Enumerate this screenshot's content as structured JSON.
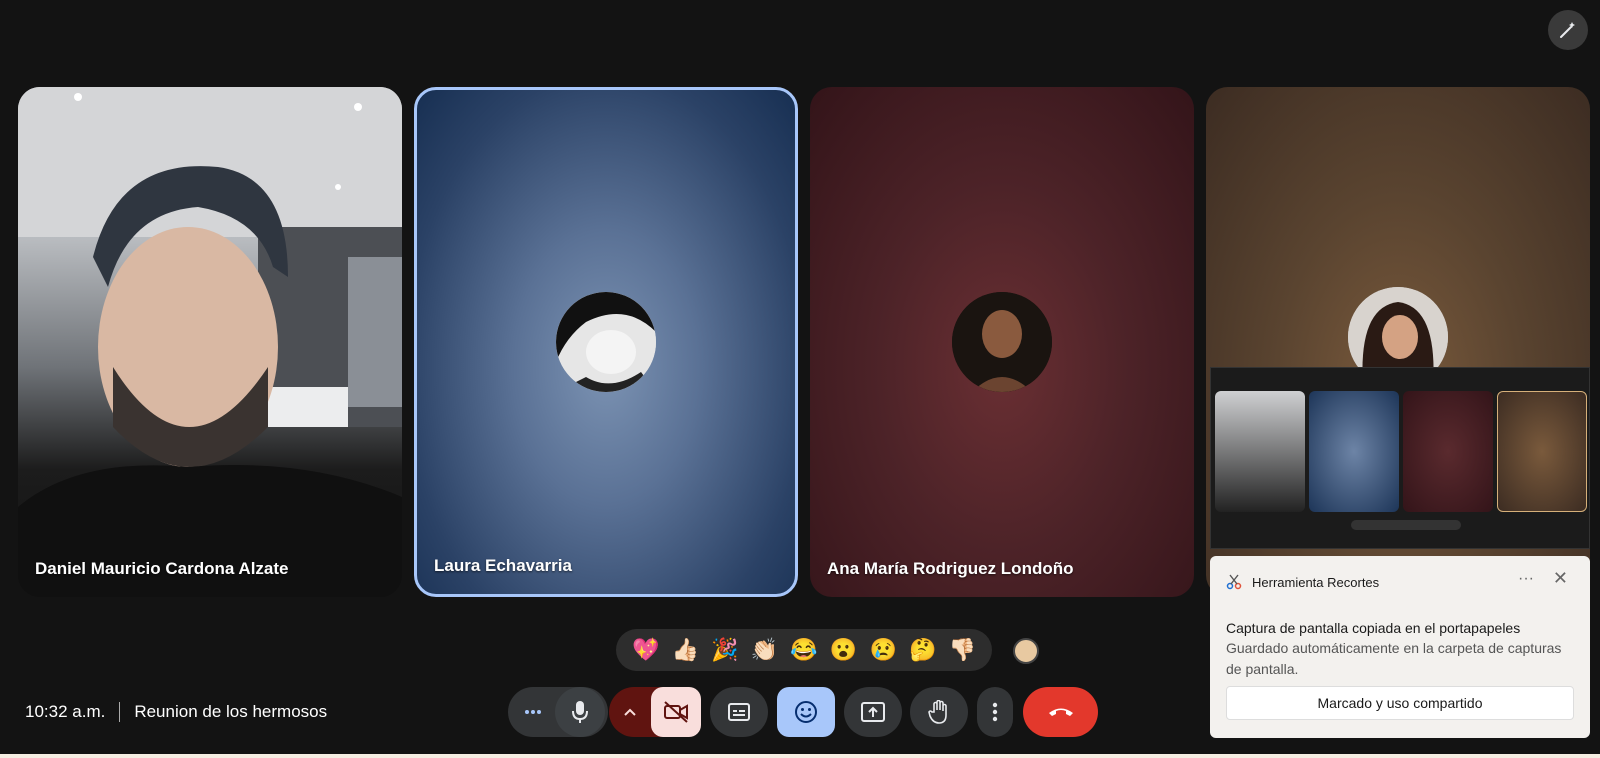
{
  "participants": [
    {
      "name": "Daniel Mauricio Cardona Alzate",
      "video": "on"
    },
    {
      "name": "Laura Echavarria",
      "video": "off",
      "active_speaker": true
    },
    {
      "name": "Ana María Rodriguez Londoño",
      "video": "off"
    },
    {
      "name": "",
      "video": "off"
    }
  ],
  "reactions": [
    "💖",
    "👍🏻",
    "🎉",
    "👏🏻",
    "😂",
    "😮",
    "😢",
    "🤔",
    "👎🏻"
  ],
  "meeting": {
    "time": "10:32 a.m.",
    "title": "Reunion de los hermosos"
  },
  "controls": {
    "more_options_icon": "more-horiz-icon",
    "mic_icon": "mic-icon",
    "camera_icon": "camera-off-icon",
    "captions_icon": "captions-icon",
    "reactions_icon": "emoji-icon",
    "present_icon": "present-screen-icon",
    "hand_icon": "raise-hand-icon",
    "menu_icon": "more-vert-icon",
    "end_call_icon": "phone-hangup-icon"
  },
  "toast": {
    "app_name": "Herramienta Recortes",
    "title": "Captura de pantalla copiada en el portapapeles",
    "body": "Guardado automáticamente en la carpeta de capturas de pantalla.",
    "button": "Marcado y uso compartido"
  },
  "colors": {
    "background": "#131313",
    "active_border": "#a8c7fa",
    "end_call": "#e3382c",
    "reaction_active": "#a8c7fa",
    "camera_off_bg": "#f9dedc"
  }
}
